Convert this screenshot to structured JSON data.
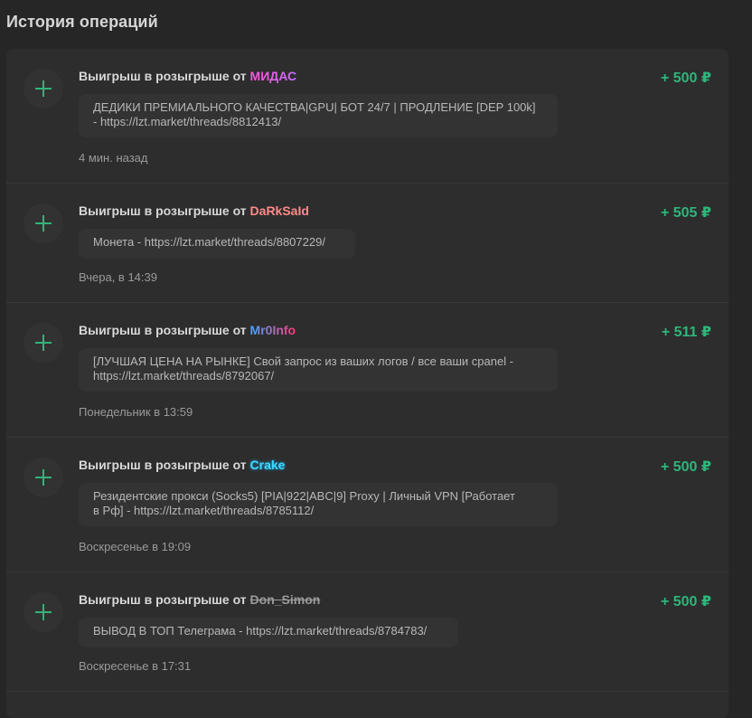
{
  "header": {
    "title": "История операций"
  },
  "icons": {
    "plus": "plus-icon"
  },
  "colors": {
    "amount": "#2db67a",
    "background": "#262626",
    "card": "#2d2d2d"
  },
  "operations": [
    {
      "title_prefix": "Выигрыш в розыгрыше от",
      "user": "МИДАС",
      "amount": "+ 500 ₽",
      "comment": "ДЕДИКИ ПРЕМИАЛЬНОГО КАЧЕСТВА|GPU| БОТ 24/7 | ПРОДЛЕНИЕ [DEP 100k]\n- https://lzt.market/threads/8812413/",
      "time": "4 мин. назад"
    },
    {
      "title_prefix": "Выигрыш в розыгрыше от",
      "user": "DaRkSaId",
      "amount": "+ 505 ₽",
      "comment": "Монета - https://lzt.market/threads/8807229/",
      "time": "Вчера, в 14:39"
    },
    {
      "title_prefix": "Выигрыш в розыгрыше от",
      "user": "Mr0Info",
      "amount": "+ 511 ₽",
      "comment": "[ЛУЧШАЯ ЦЕНА НА РЫНКЕ] Свой запрос из ваших логов / все ваши cpanel -\nhttps://lzt.market/threads/8792067/",
      "time": "Понедельник в 13:59"
    },
    {
      "title_prefix": "Выигрыш в розыгрыше от",
      "user": "Crake",
      "amount": "+ 500 ₽",
      "comment": "Резидентские прокси (Socks5) [PIA|922|ABC|9] Proxy | Личный VPN [Работает\nв Рф] - https://lzt.market/threads/8785112/",
      "time": "Воскресенье в 19:09"
    },
    {
      "title_prefix": "Выигрыш в розыгрыше от",
      "user": "Don_Simon",
      "amount": "+ 500 ₽",
      "comment": "ВЫВОД В ТОП Телеграма - https://lzt.market/threads/8784783/",
      "time": "Воскресенье в 17:31"
    }
  ]
}
